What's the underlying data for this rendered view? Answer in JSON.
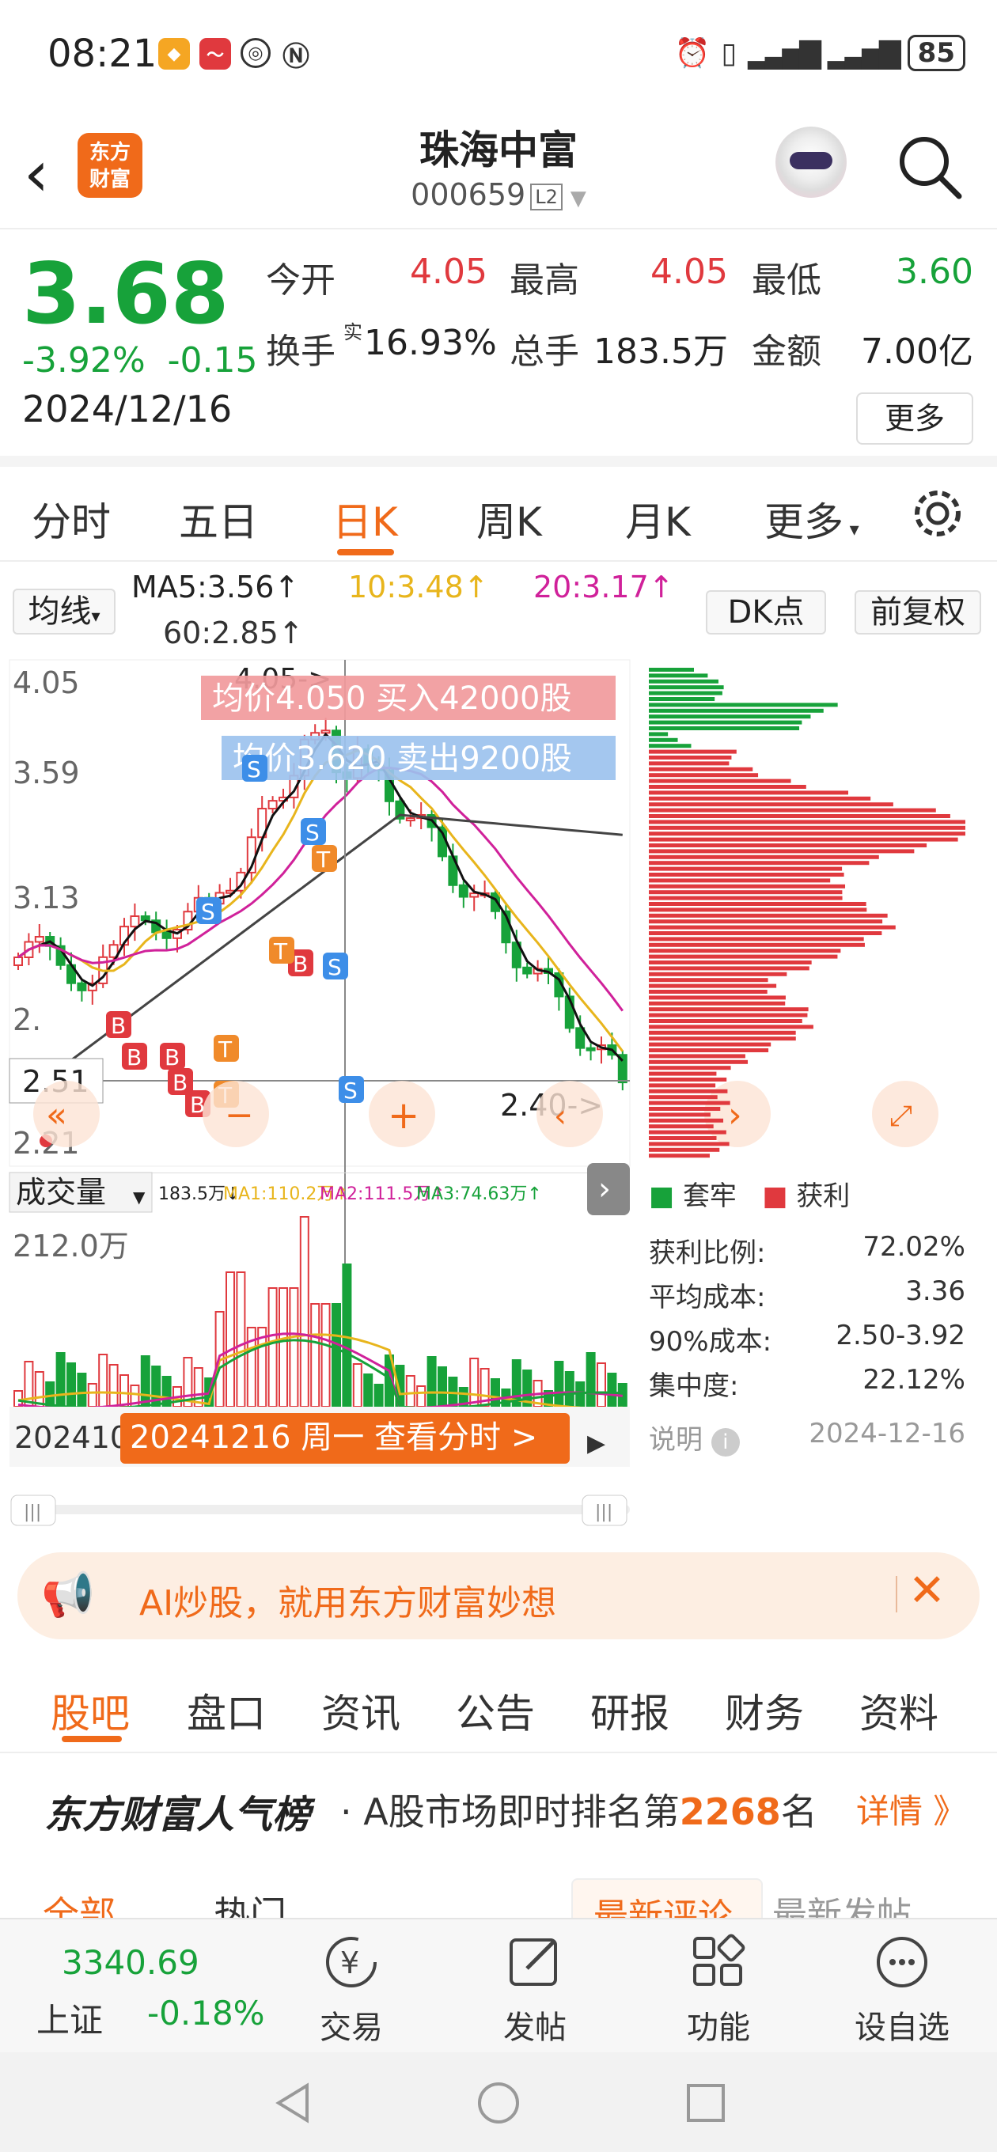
{
  "status": {
    "time": "08:21",
    "battery": "85"
  },
  "header": {
    "logo": "东方财富",
    "name": "珠海中富",
    "code": "000659",
    "level": "L2"
  },
  "quote": {
    "price": "3.68",
    "pct": "-3.92%",
    "chg": "-0.15",
    "date": "2024/12/16",
    "open_label": "今开",
    "open": "4.05",
    "high_label": "最高",
    "high": "4.05",
    "low_label": "最低",
    "low": "3.60",
    "turnover_label": "换手",
    "turnover_sup": "实",
    "turnover": "16.93%",
    "vol_label": "总手",
    "vol": "183.5万",
    "amt_label": "金额",
    "amt": "7.00亿",
    "more": "更多"
  },
  "ktabs": [
    "分时",
    "五日",
    "日K",
    "周K",
    "月K",
    "更多"
  ],
  "ma": {
    "selector": "均线",
    "ma5": "MA5:3.56↑",
    "ma10": "10:3.48↑",
    "ma20": "20:3.17↑",
    "ma60": "60:2.85↑",
    "dk": "DK点",
    "fq": "前复权"
  },
  "chart": {
    "y_top": "4.05",
    "y2": "3.59",
    "y3": "3.13",
    "y4": "2.",
    "y_bot": "2.21",
    "cursor_price": "2.51",
    "hi_mark": "4.05->",
    "lo_mark": "2.40->",
    "buy_note": "均价4.050  买入42000股",
    "sell_note": "均价3.620  卖出9200股",
    "vol_selector": "成交量",
    "vol_total": "183.5万↓",
    "vol_ma1": "MA1:110.2万↑",
    "vol_ma2": "MA2:111.5万↑",
    "vol_ma3": "MA3:74.63万↑",
    "vol_max": "212.0万",
    "date_left": "202410",
    "date_tip": "20241216 周一 查看分时 >"
  },
  "colors": {
    "up": "#e0393e",
    "down": "#17a23a",
    "accent": "#f06a1a",
    "ma5": "#111111",
    "ma10": "#e8b51c",
    "ma20": "#d0219a",
    "ma60": "#444444"
  },
  "chip": {
    "legend_trap": "套牢",
    "legend_profit": "获利",
    "rows": [
      {
        "label": "获利比例:",
        "value": "72.02%"
      },
      {
        "label": "平均成本:",
        "value": "3.36"
      },
      {
        "label": "90%成本:",
        "value": "2.50-3.92"
      },
      {
        "label": "集中度:",
        "value": "22.12%"
      }
    ],
    "note_label": "说明",
    "note_date": "2024-12-16"
  },
  "ad": {
    "text": "AI炒股，就用东方财富妙想"
  },
  "btabs": [
    "股吧",
    "盘口",
    "资讯",
    "公告",
    "研报",
    "财务",
    "资料"
  ],
  "rank": {
    "title": "东方财富人气榜",
    "prefix": "· A股市场即时排名第",
    "num": "2268",
    "suffix": "名",
    "detail": "详情 》"
  },
  "subtabs": [
    "全部",
    "热门",
    "最新评论",
    "最新发帖"
  ],
  "nav": {
    "index_val": "3340.69",
    "index_name": "上证",
    "index_chg": "-0.18%",
    "items": [
      "交易",
      "发帖",
      "功能",
      "设自选"
    ]
  }
}
